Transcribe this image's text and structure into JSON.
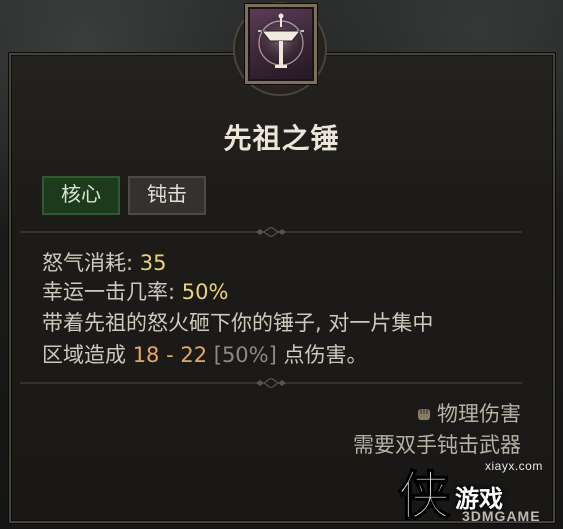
{
  "skill": {
    "name": "先祖之锤",
    "tags": [
      "核心",
      "钝击"
    ],
    "icon": "hammer-skill-icon"
  },
  "stats": {
    "fury_label": "怒气消耗:",
    "fury_value": "35",
    "luck_label": "幸运一击几率:",
    "luck_value": "50%"
  },
  "description": {
    "line1": "带着先祖的怒火砸下你的锤子, 对一片集中",
    "line2_prefix": "区域造成 ",
    "damage": "18 - 22",
    "percent": "[50%]",
    "line2_suffix": " 点伤害。"
  },
  "footer": {
    "damage_type": "物理伤害",
    "requirement": "需要双手钝击武器"
  },
  "watermark": {
    "site": "xiayx.com",
    "brand": "游戏",
    "sub": "3DMGAME",
    "logo_char": "侠"
  },
  "colors": {
    "value_yellow": "#ead27a",
    "damage_orange": "#e7a860",
    "tag_core_green": "#1d3a1d"
  }
}
